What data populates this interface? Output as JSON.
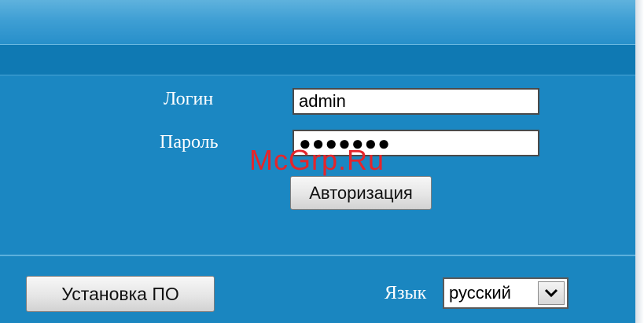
{
  "login": {
    "label": "Логин",
    "value": "admin"
  },
  "password": {
    "label": "Пароль",
    "masked_value": "●●●●●●●"
  },
  "auth_button_label": "Авторизация",
  "firmware_button_label": "Установка ПО",
  "language": {
    "label": "Язык",
    "selected": "русский"
  },
  "watermark": "McGrp.Ru",
  "colors": {
    "panel": "#1b87c2",
    "band": "#0f79b3",
    "watermark": "#e5252b"
  }
}
